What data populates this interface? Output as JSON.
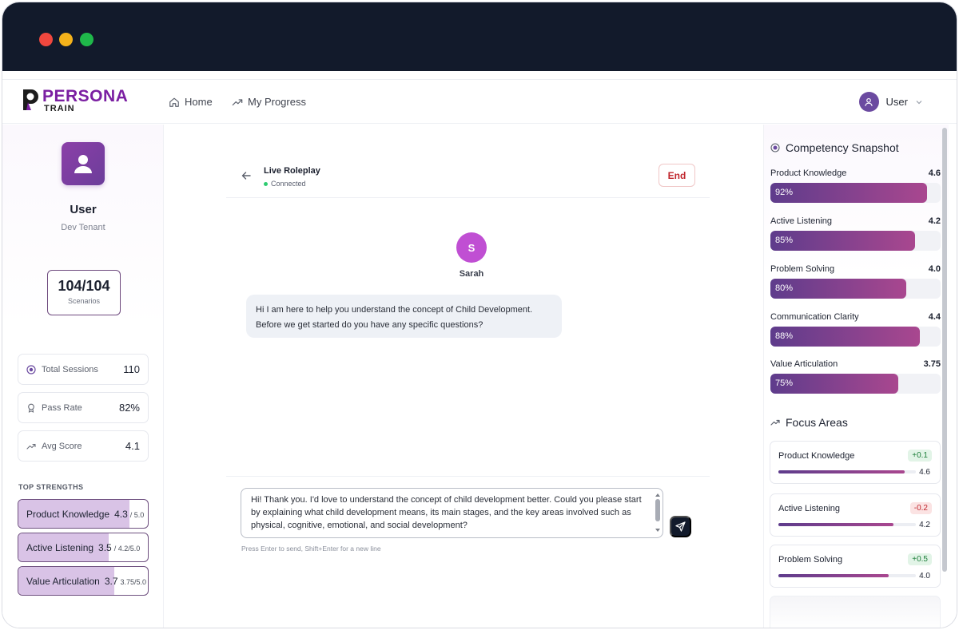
{
  "nav": {
    "logo_text": "PERSONA",
    "logo_sub": "TRAIN",
    "home": "Home",
    "progress": "My Progress",
    "user": "User"
  },
  "profile": {
    "name": "User",
    "tenant": "Dev Tenant",
    "scenarios_count": "104/104",
    "scenarios_label": "Scenarios"
  },
  "stats": [
    {
      "label": "Total Sessions",
      "value": "110",
      "icon": "clock-icon"
    },
    {
      "label": "Pass Rate",
      "value": "82%",
      "icon": "award-icon"
    },
    {
      "label": "Avg Score",
      "value": "4.1",
      "icon": "trend-icon"
    }
  ],
  "strengths": {
    "title": "TOP STRENGTHS",
    "items": [
      {
        "label": "Product Knowledge",
        "value": "4.3",
        "max": "/ 5.0",
        "fill": 0.86
      },
      {
        "label": "Active Listening",
        "value": "3.5",
        "max": "/ 4.2/5.0",
        "fill": 0.7
      },
      {
        "label": "Value Articulation",
        "value": "3.7",
        "max": "3.75/5.0",
        "fill": 0.74
      }
    ]
  },
  "chat": {
    "title": "Live Roleplay",
    "status": "Connected",
    "end_label": "End",
    "persona_initial": "S",
    "persona_name": "Sarah",
    "message": "Hi I am here to help you understand the concept of Child Development. Before we get started do you have any specific questions?",
    "draft": "Hi! Thank you. I'd love to understand the concept of child development better. Could you please start by explaining what child development means, its main stages, and the key areas involved such as physical, cognitive, emotional, and social development?",
    "hint": "Press Enter to send, Shift+Enter for a new line"
  },
  "competency": {
    "title": "Competency Snapshot",
    "items": [
      {
        "label": "Product Knowledge",
        "score": "4.6",
        "pct": "92%",
        "fill": 0.92
      },
      {
        "label": "Active Listening",
        "score": "4.2",
        "pct": "85%",
        "fill": 0.85
      },
      {
        "label": "Problem Solving",
        "score": "4.0",
        "pct": "80%",
        "fill": 0.8
      },
      {
        "label": "Communication Clarity",
        "score": "4.4",
        "pct": "88%",
        "fill": 0.88
      },
      {
        "label": "Value Articulation",
        "score": "3.75",
        "pct": "75%",
        "fill": 0.75
      }
    ]
  },
  "focus": {
    "title": "Focus Areas",
    "items": [
      {
        "label": "Product Knowledge",
        "delta": "+0.1",
        "trend": "pos",
        "score": "4.6",
        "fill": 0.92
      },
      {
        "label": "Active Listening",
        "delta": "-0.2",
        "trend": "neg",
        "score": "4.2",
        "fill": 0.84
      },
      {
        "label": "Problem Solving",
        "delta": "+0.5",
        "trend": "pos",
        "score": "4.0",
        "fill": 0.8
      }
    ]
  },
  "colors": {
    "titlebar": "#121a2b",
    "brand": "#7b1fa2",
    "accent_start": "#5e3c8c",
    "accent_end": "#a9478f",
    "end_red": "#c0262d",
    "connected_green": "#2ecc71"
  }
}
